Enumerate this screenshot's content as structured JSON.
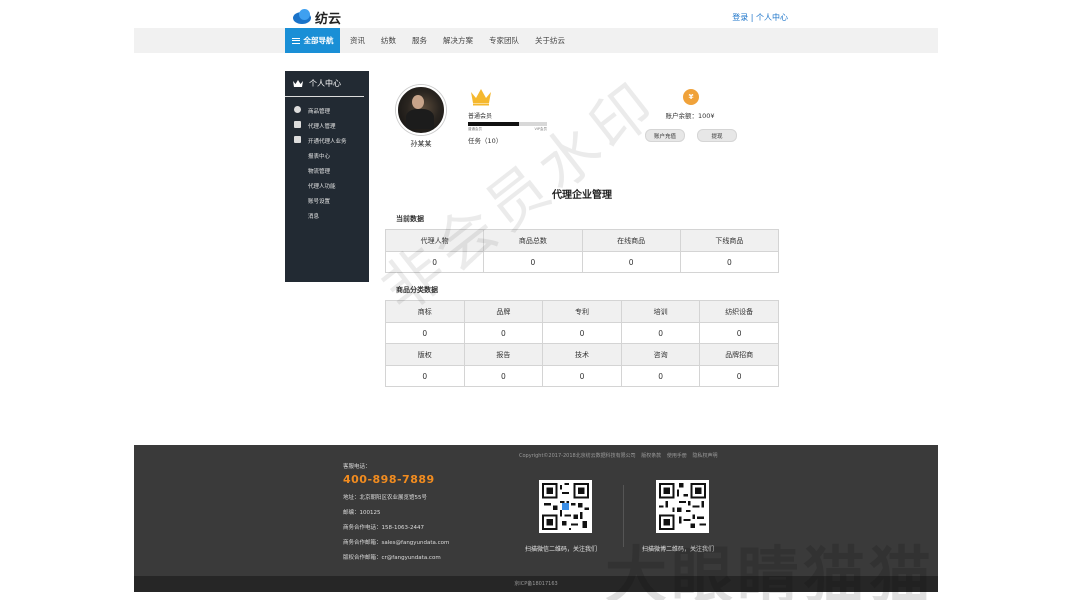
{
  "header": {
    "logo_text": "纺云",
    "login": "登录",
    "separator": "|",
    "user_center": "个人中心"
  },
  "nav": {
    "all_label": "全部导航",
    "items": [
      "资讯",
      "纺数",
      "服务",
      "解决方案",
      "专家团队",
      "关于纺云"
    ]
  },
  "sidebar": {
    "title": "个人中心",
    "items": [
      "商品管理",
      "代理人管理",
      "开通代理人业务",
      "报表中心",
      "物流管理",
      "代理人功能",
      "账号设置",
      "消息"
    ]
  },
  "profile": {
    "username": "孙某某",
    "member_level": "普通会员",
    "progress_fraction": 0.64,
    "progress_tick_start": "普通会员",
    "progress_tick_end": "VIP会员",
    "task_label": "任务（10）",
    "balance_label": "账户余额：100¥",
    "recharge_button": "账户充值",
    "withdraw_button": "提现",
    "money_icon_glyph": "¥"
  },
  "main": {
    "title": "代理企业管理",
    "current_section": "当前数据",
    "current_headers": [
      "代理人物",
      "商品总数",
      "在线商品",
      "下线商品"
    ],
    "current_values": [
      "0",
      "0",
      "0",
      "0"
    ],
    "category_section": "商品分类数据",
    "category_row1_headers": [
      "商标",
      "品牌",
      "专利",
      "培训",
      "纺织设备"
    ],
    "category_row1_values": [
      "0",
      "0",
      "0",
      "0",
      "0"
    ],
    "category_row2_headers": [
      "版权",
      "报告",
      "技术",
      "咨询",
      "品牌招商"
    ],
    "category_row2_values": [
      "0",
      "0",
      "0",
      "0",
      "0"
    ]
  },
  "watermarks": {
    "diagonal": "非会员水印",
    "corner": "大眼睛猫猫"
  },
  "footer": {
    "copyright": "Copyright©2017-2018北京纺云数据科技有限公司",
    "links": [
      "版权条款",
      "使用手册",
      "隐私权声明"
    ],
    "hotline_label": "客服电话：",
    "hotline": "400-898-7889",
    "address": "地址：北京朝阳区农业展览馆55号",
    "postcode": "邮编：100125",
    "biz_phone": "商务合作电话：158-1063-2447",
    "biz_email": "商务合作邮箱：sales@fangyundata.com",
    "copyright_email": "版权合作邮箱：cr@fangyundata.com",
    "qr_wechat_caption": "扫描微信二维码，关注我们",
    "qr_weibo_caption": "扫描微博二维码，关注我们",
    "icp": "京ICP备18017163"
  },
  "colors": {
    "accent": "#1a8fd6",
    "sidebar_bg": "#222a33",
    "footer_bg": "#3a3a3a",
    "hotline": "#f28c1f",
    "crown": "#f5b82e"
  }
}
